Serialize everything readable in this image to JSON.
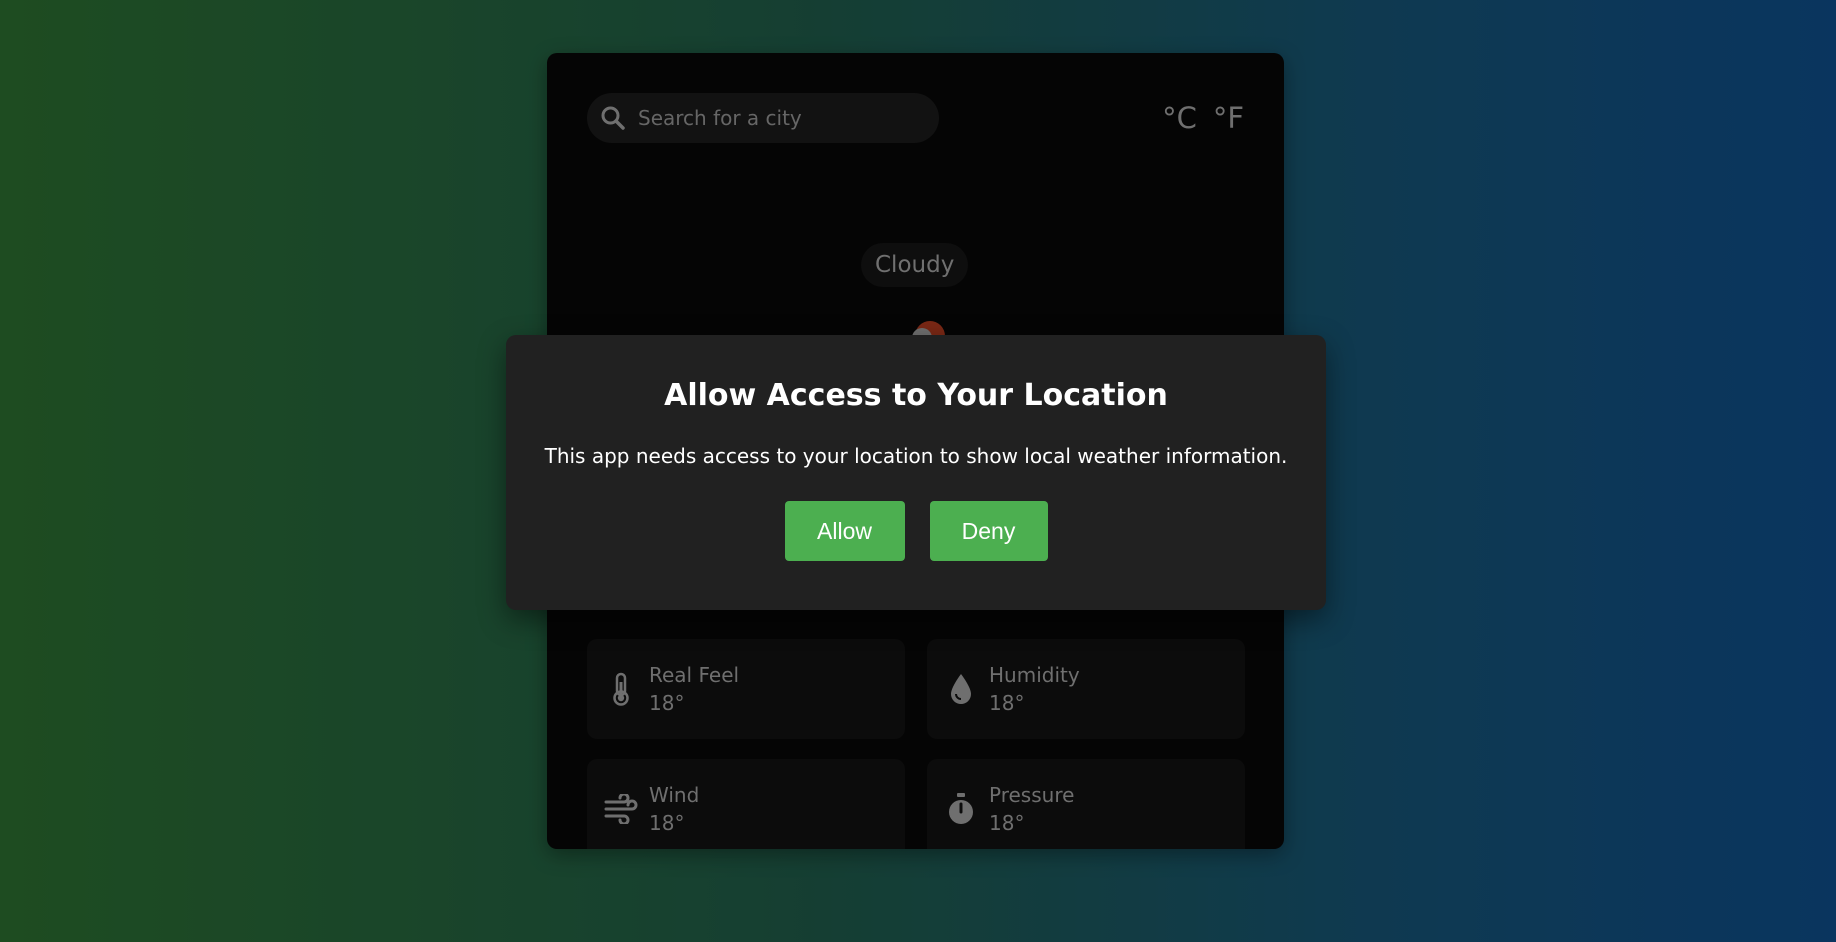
{
  "search": {
    "placeholder": "Search for a city"
  },
  "units": {
    "celsius": "°C",
    "fahrenheit": "°F"
  },
  "weather": {
    "condition": "Cloudy"
  },
  "stats": {
    "real_feel": {
      "label": "Real Feel",
      "value": "18°"
    },
    "humidity": {
      "label": "Humidity",
      "value": "18°"
    },
    "wind": {
      "label": "Wind",
      "value": "18°"
    },
    "pressure": {
      "label": "Pressure",
      "value": "18°"
    }
  },
  "modal": {
    "title": "Allow Access to Your Location",
    "message": "This app needs access to your location to show local weather information.",
    "allow_label": "Allow",
    "deny_label": "Deny"
  },
  "colors": {
    "button": "#4caf50",
    "modal_bg": "#212121",
    "card_bg": "#070707"
  },
  "icons": {
    "search": "search-icon",
    "weather": "cloud-sun-icon",
    "real_feel": "thermometer-icon",
    "humidity": "droplet-icon",
    "wind": "wind-icon",
    "pressure": "stopwatch-icon"
  }
}
